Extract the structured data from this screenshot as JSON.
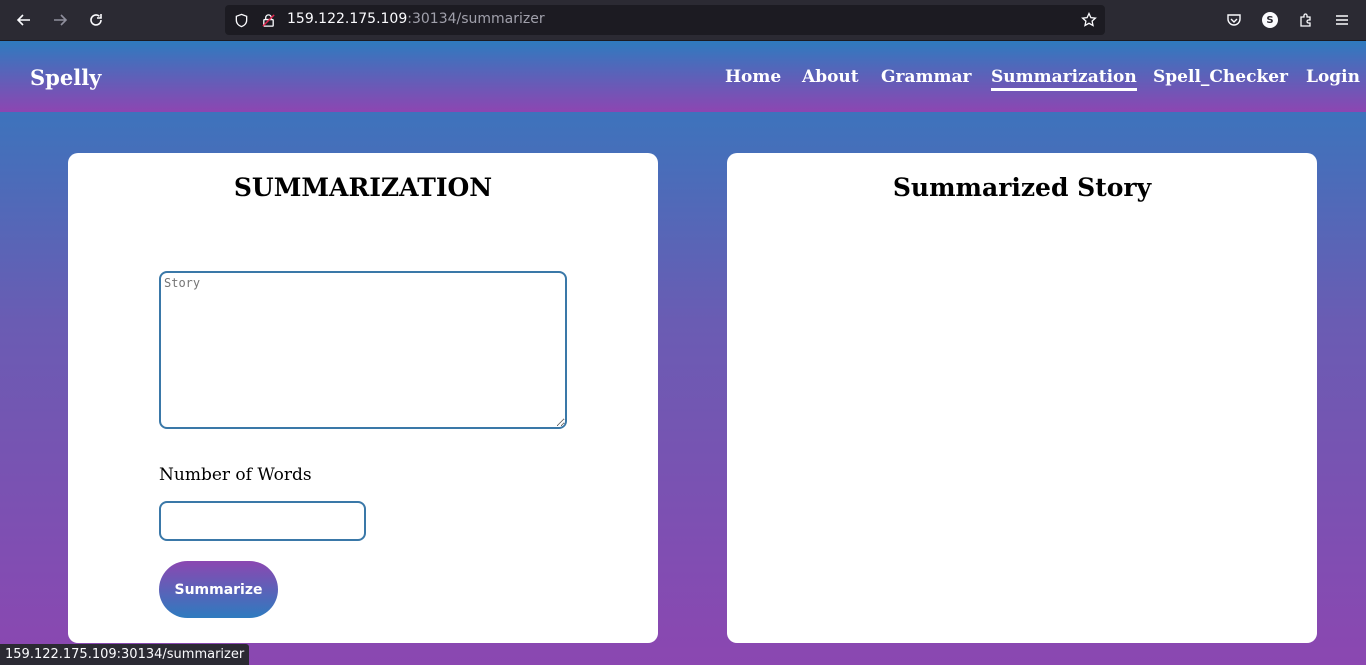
{
  "browser": {
    "url_host": "159.122.175.109",
    "url_rest": ":30134/summarizer",
    "status_url": "159.122.175.109:30134/summarizer",
    "profile_initial": "S"
  },
  "navbar": {
    "brand": "Spelly",
    "links": [
      "Home",
      "About",
      "Grammar",
      "Summarization",
      "Spell_Checker",
      "Login"
    ],
    "active": "Summarization"
  },
  "left_card": {
    "title": "SUMMARIZATION",
    "story_placeholder": "Story",
    "words_label": "Number of Words",
    "words_value": "",
    "button_label": "Summarize"
  },
  "right_card": {
    "title": "Summarized Story"
  },
  "colors": {
    "gradient_top": "#2e7bbf",
    "gradient_bottom": "#8b47b1",
    "input_border": "#3a78a8"
  }
}
